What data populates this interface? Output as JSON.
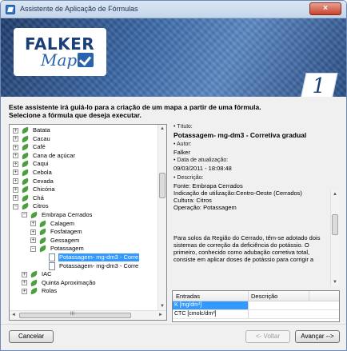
{
  "window": {
    "title": "Assistente de Aplicação de Fórmulas",
    "close_glyph": "×"
  },
  "banner": {
    "logo_line1": "FALKER",
    "logo_line2": "Map",
    "step_number": "1"
  },
  "intro": {
    "line1": "Este assistente irá guiá-lo para a criação de um mapa a partir de uma fórmula.",
    "line2": "Selecione a fórmula que deseja executar."
  },
  "tree": {
    "items": [
      {
        "label": "Batata",
        "level": 0,
        "expander": "+",
        "icon": "leaf-icon"
      },
      {
        "label": "Cacau",
        "level": 0,
        "expander": "+",
        "icon": "leaf-icon"
      },
      {
        "label": "Café",
        "level": 0,
        "expander": "+",
        "icon": "leaf-icon"
      },
      {
        "label": "Cana de açúcar",
        "level": 0,
        "expander": "+",
        "icon": "leaf-icon"
      },
      {
        "label": "Caqui",
        "level": 0,
        "expander": "+",
        "icon": "leaf-icon"
      },
      {
        "label": "Cebola",
        "level": 0,
        "expander": "+",
        "icon": "leaf-icon"
      },
      {
        "label": "Cevada",
        "level": 0,
        "expander": "+",
        "icon": "leaf-icon"
      },
      {
        "label": "Chicória",
        "level": 0,
        "expander": "+",
        "icon": "leaf-icon"
      },
      {
        "label": "Chá",
        "level": 0,
        "expander": "+",
        "icon": "leaf-icon"
      },
      {
        "label": "Citros",
        "level": 0,
        "expander": "−",
        "icon": "leaf-icon"
      },
      {
        "label": "Embrapa Cerrados",
        "level": 1,
        "expander": "−",
        "icon": "leaf-icon"
      },
      {
        "label": "Calagem",
        "level": 2,
        "expander": "+",
        "icon": "leaf-icon"
      },
      {
        "label": "Fosfatagem",
        "level": 2,
        "expander": "+",
        "icon": "leaf-icon"
      },
      {
        "label": "Gessagem",
        "level": 2,
        "expander": "+",
        "icon": "leaf-icon"
      },
      {
        "label": "Potassagem",
        "level": 2,
        "expander": "−",
        "icon": "leaf-icon"
      },
      {
        "label": "Potassagem- mg-dm3 - Corre",
        "level": 3,
        "expander": "",
        "icon": "formula-document-icon",
        "selected": true
      },
      {
        "label": "Potassagem- mg-dm3 - Corre",
        "level": 3,
        "expander": "",
        "icon": "formula-document-icon"
      },
      {
        "label": "IAC",
        "level": 1,
        "expander": "+",
        "icon": "leaf-icon"
      },
      {
        "label": "Quinta Aproximação",
        "level": 1,
        "expander": "+",
        "icon": "leaf-icon"
      },
      {
        "label": "Rolas",
        "level": 1,
        "expander": "+",
        "icon": "leaf-icon"
      }
    ],
    "hscroll_grip": "III",
    "scroll_up": "▲",
    "scroll_down": "▼",
    "scroll_left": "◄",
    "scroll_right": "►"
  },
  "details": {
    "title_label": "• Título:",
    "title_value": "Potassagem- mg-dm3 - Corretiva gradual",
    "author_label": "• Autor:",
    "author_value": "Falker",
    "date_label": "• Data de atualização:",
    "date_value": "09/03/2011 - 18:08:48",
    "desc_label": "• Descrição:",
    "desc_lines": [
      "Fonte: Embrapa Cerrados",
      "Indicação de utilização:Centro-Oeste (Cerrados)",
      "Cultura: Citros",
      "Operação: Potassagem"
    ],
    "body_lines": [
      "Para solos da Região do Cerrado, têm-se adotado dois",
      "sistemas de correção da deficiência do potássio.  O",
      "primeiro, conhecido como adubação corretiva total,",
      "consiste em aplicar doses de potássio para corrigir a"
    ]
  },
  "entries": {
    "headers": [
      "Entradas",
      "Descrição"
    ],
    "rows": [
      {
        "name": "K [mg/dm³]",
        "desc": ""
      },
      {
        "name": "CTC [cmolc/dm³]",
        "desc": ""
      }
    ]
  },
  "footer": {
    "cancel": "Cancelar",
    "back": "<- Voltar",
    "next": "Avançar -->"
  }
}
